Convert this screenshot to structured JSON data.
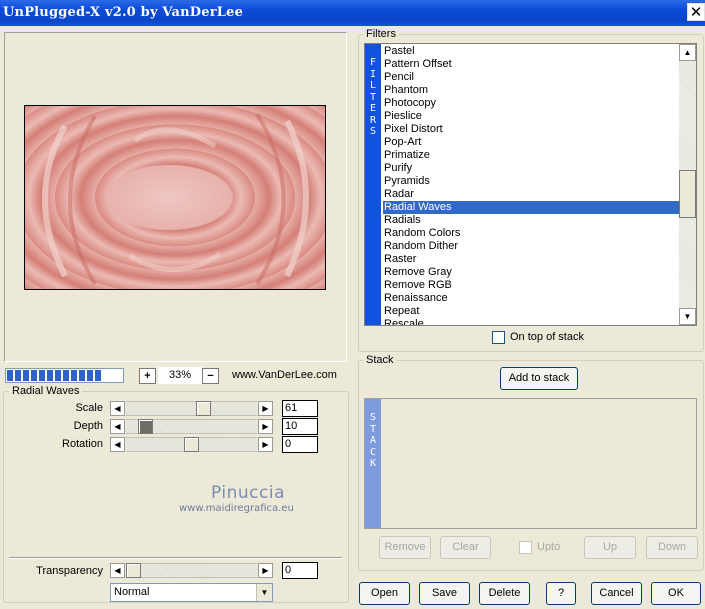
{
  "window": {
    "title": "UnPlugged-X v2.0 by VanDerLee",
    "close_glyph": "✕"
  },
  "preview": {
    "progress_segments": 12,
    "zoom_minus": "−",
    "zoom_plus": "+",
    "zoom": "33%",
    "website": "www.VanDerLee.com"
  },
  "params": {
    "group_title": "Radial Waves",
    "items": [
      {
        "label": "Scale",
        "value": "61"
      },
      {
        "label": "Depth",
        "value": "10"
      },
      {
        "label": "Rotation",
        "value": "0"
      }
    ],
    "watermark_name": "Pinuccia",
    "watermark_url": "www.maidiregrafica.eu"
  },
  "transparency": {
    "label": "Transparency",
    "value": "0",
    "blend_mode": "Normal"
  },
  "filters": {
    "group_title": "Filters",
    "side_label": [
      "F",
      "I",
      "L",
      "T",
      "E",
      "R",
      "S"
    ],
    "items": [
      "Pastel",
      "Pattern Offset",
      "Pencil",
      "Phantom",
      "Photocopy",
      "Pieslice",
      "Pixel Distort",
      "Pop-Art",
      "Primatize",
      "Purify",
      "Pyramids",
      "Radar",
      "Radial Waves",
      "Radials",
      "Random Colors",
      "Random Dither",
      "Raster",
      "Remove Gray",
      "Remove RGB",
      "Renaissance",
      "Repeat",
      "Rescale"
    ],
    "selected": "Radial Waves",
    "on_top_label": "On top of stack"
  },
  "stack": {
    "group_title": "Stack",
    "add_button": "Add to stack",
    "side_label": [
      "S",
      "T",
      "A",
      "C",
      "K"
    ],
    "remove": "Remove",
    "clear": "Clear",
    "upto": "Upto",
    "up": "Up",
    "down": "Down"
  },
  "bottom_buttons": {
    "open": "Open",
    "save": "Save",
    "delete": "Delete",
    "help": "?",
    "cancel": "Cancel",
    "ok": "OK"
  }
}
